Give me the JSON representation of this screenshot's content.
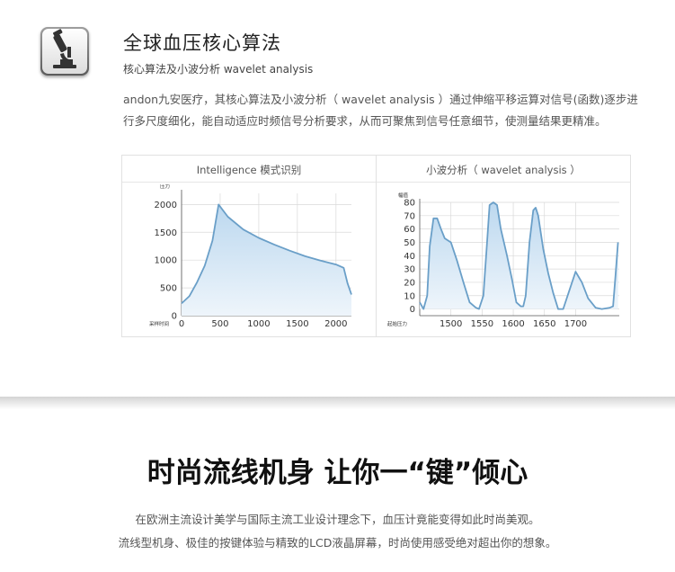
{
  "header": {
    "title": "全球血压核心算法",
    "subtitle": "核心算法及小波分析 wavelet analysis",
    "icon": "microscope-icon",
    "description_line1": "andon九安医疗，其核心算法及小波分析（ wavelet analysis ）通过伸缩平移运算对信号(函数)逐步进",
    "description_line2": "行多尺度细化，能自动适应时频信号分析要求，从而可聚焦到信号任意细节，使测量结果更精准。"
  },
  "chart_data": [
    {
      "type": "area",
      "title": "Intelligence 模式识别",
      "xlabel": "采样时间",
      "ylabel": "压力",
      "xlim": [
        0,
        2200
      ],
      "ylim": [
        0,
        2200
      ],
      "x_ticks": [
        "0",
        "500",
        "1000",
        "1500",
        "2000"
      ],
      "y_ticks": [
        "0",
        "500",
        "1000",
        "1500",
        "2000"
      ],
      "grid": true,
      "series": [
        {
          "x": [
            0,
            100,
            200,
            300,
            400,
            480,
            600,
            800,
            1000,
            1200,
            1400,
            1600,
            1800,
            2000,
            2100,
            2150,
            2200
          ],
          "y": [
            220,
            350,
            600,
            900,
            1350,
            2000,
            1780,
            1550,
            1400,
            1280,
            1170,
            1070,
            990,
            920,
            860,
            580,
            380
          ]
        }
      ]
    },
    {
      "type": "area",
      "title": "小波分析（ wavelet analysis ）",
      "xlabel": "起始压力",
      "ylabel": "幅值",
      "xlim": [
        1450,
        1770
      ],
      "ylim": [
        -5,
        80
      ],
      "x_ticks": [
        "1500",
        "1550",
        "1600",
        "1650",
        "1700"
      ],
      "y_ticks": [
        "0",
        "10",
        "20",
        "30",
        "40",
        "50",
        "60",
        "70",
        "80"
      ],
      "grid": true,
      "series": [
        {
          "x": [
            1450,
            1456,
            1462,
            1466,
            1472,
            1478,
            1484,
            1490,
            1500,
            1510,
            1520,
            1530,
            1540,
            1545,
            1552,
            1558,
            1562,
            1568,
            1574,
            1580,
            1590,
            1598,
            1605,
            1612,
            1616,
            1620,
            1626,
            1632,
            1636,
            1640,
            1648,
            1656,
            1664,
            1672,
            1676,
            1680,
            1690,
            1700,
            1710,
            1720,
            1732,
            1742,
            1755,
            1760,
            1764,
            1768
          ],
          "y": [
            5,
            0,
            10,
            47,
            68,
            68,
            60,
            53,
            50,
            36,
            20,
            5,
            1,
            0,
            10,
            50,
            78,
            80,
            78,
            60,
            40,
            22,
            5,
            2,
            2,
            10,
            50,
            74,
            76,
            70,
            45,
            27,
            12,
            0,
            0,
            0,
            14,
            28,
            20,
            8,
            1,
            0,
            1,
            2,
            25,
            50
          ]
        }
      ]
    }
  ],
  "separator": {
    "headline": "时尚流线机身 让你一“键”倾心",
    "line1": "在欧洲主流设计美学与国际主流工业设计理念下，血压计竟能变得如此时尚美观。",
    "line2": "流线型机身、极佳的按键体验与精致的LCD液晶屏幕，时尚使用感受绝对超出你的想象。"
  },
  "colors": {
    "line": "#6a9fc8",
    "fill_top": "#bcd8ef",
    "fill_bottom": "#eef5fb",
    "grid": "#d9d9d9"
  }
}
